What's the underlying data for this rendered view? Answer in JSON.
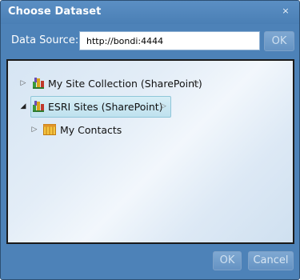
{
  "dialog": {
    "title": "Choose Dataset",
    "close_glyph": "×"
  },
  "data_source": {
    "label": "Data Source:",
    "value": "http://bondi:4444",
    "ok_label": "OK"
  },
  "tree": {
    "nodes": [
      {
        "label": "My Site Collection (SharePoint)",
        "icon": "sharepoint-site-icon",
        "expanded": false,
        "selected": false
      },
      {
        "label": "ESRI Sites (SharePoint)",
        "icon": "sharepoint-site-icon",
        "expanded": true,
        "selected": true
      },
      {
        "label": "My Contacts",
        "icon": "list-icon",
        "expanded": false,
        "selected": false
      }
    ]
  },
  "footer": {
    "ok_label": "OK",
    "cancel_label": "Cancel"
  },
  "colors": {
    "dialog_bg": "#4d82b8",
    "selection": "#bfe1ee"
  }
}
